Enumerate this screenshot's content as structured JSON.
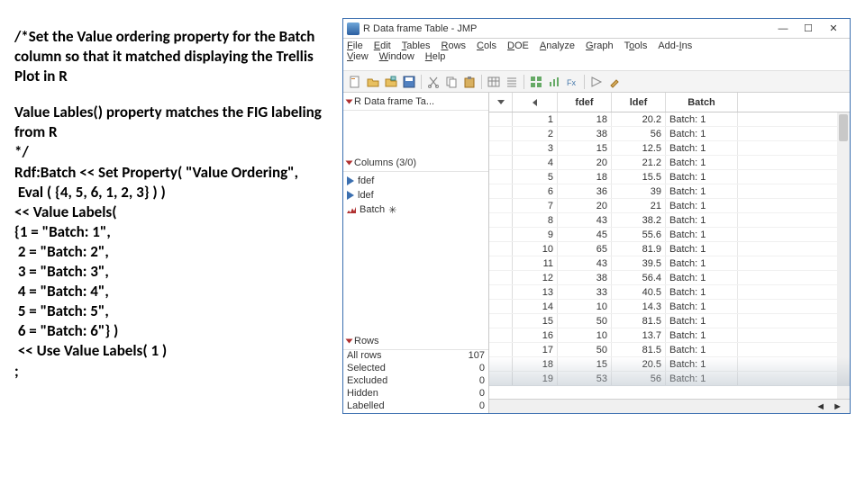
{
  "left": {
    "block1": "/*Set the Value ordering property for the Batch column so that it matched displaying the Trellis Plot in R",
    "block2": "Value Lables() property matches the FIG labeling from R\n*/\nRdf:Batch << Set Property( \"Value Ordering\",\n Eval ( {4, 5, 6, 1, 2, 3} ) )\n<< Value Labels(\n{1 = \"Batch: 1\",\n 2 = \"Batch: 2\",\n 3 = \"Batch: 3\",\n 4 = \"Batch: 4\",\n 5 = \"Batch: 5\",\n 6 = \"Batch: 6\"} )\n << Use Value Labels( 1 )\n;"
  },
  "jmp": {
    "title": "R Data frame Table - JMP",
    "menus": [
      "File",
      "Edit",
      "Tables",
      "Rows",
      "Cols",
      "DOE",
      "Analyze",
      "Graph",
      "Tools",
      "Add-Ins",
      "View",
      "Window",
      "Help"
    ],
    "side_table_label": "R Data frame Ta...",
    "columns_header": "Columns (3/0)",
    "columns": [
      {
        "name": "fdef",
        "type": "blue"
      },
      {
        "name": "ldef",
        "type": "blue"
      },
      {
        "name": "Batch",
        "type": "red",
        "star": "✳"
      }
    ],
    "rows_header": "Rows",
    "rows_stats": [
      {
        "label": "All rows",
        "val": "107"
      },
      {
        "label": "Selected",
        "val": "0"
      },
      {
        "label": "Excluded",
        "val": "0"
      },
      {
        "label": "Hidden",
        "val": "0"
      },
      {
        "label": "Labelled",
        "val": "0"
      }
    ],
    "grid_cols": [
      "fdef",
      "ldef",
      "Batch"
    ],
    "grid_rows": [
      {
        "n": "1",
        "fdef": "18",
        "ldef": "20.2",
        "batch": "Batch: 1"
      },
      {
        "n": "2",
        "fdef": "38",
        "ldef": "56",
        "batch": "Batch: 1"
      },
      {
        "n": "3",
        "fdef": "15",
        "ldef": "12.5",
        "batch": "Batch: 1"
      },
      {
        "n": "4",
        "fdef": "20",
        "ldef": "21.2",
        "batch": "Batch: 1"
      },
      {
        "n": "5",
        "fdef": "18",
        "ldef": "15.5",
        "batch": "Batch: 1"
      },
      {
        "n": "6",
        "fdef": "36",
        "ldef": "39",
        "batch": "Batch: 1"
      },
      {
        "n": "7",
        "fdef": "20",
        "ldef": "21",
        "batch": "Batch: 1"
      },
      {
        "n": "8",
        "fdef": "43",
        "ldef": "38.2",
        "batch": "Batch: 1"
      },
      {
        "n": "9",
        "fdef": "45",
        "ldef": "55.6",
        "batch": "Batch: 1"
      },
      {
        "n": "10",
        "fdef": "65",
        "ldef": "81.9",
        "batch": "Batch: 1"
      },
      {
        "n": "11",
        "fdef": "43",
        "ldef": "39.5",
        "batch": "Batch: 1"
      },
      {
        "n": "12",
        "fdef": "38",
        "ldef": "56.4",
        "batch": "Batch: 1"
      },
      {
        "n": "13",
        "fdef": "33",
        "ldef": "40.5",
        "batch": "Batch: 1"
      },
      {
        "n": "14",
        "fdef": "10",
        "ldef": "14.3",
        "batch": "Batch: 1"
      },
      {
        "n": "15",
        "fdef": "50",
        "ldef": "81.5",
        "batch": "Batch: 1"
      },
      {
        "n": "16",
        "fdef": "10",
        "ldef": "13.7",
        "batch": "Batch: 1"
      },
      {
        "n": "17",
        "fdef": "50",
        "ldef": "81.5",
        "batch": "Batch: 1"
      },
      {
        "n": "18",
        "fdef": "15",
        "ldef": "20.5",
        "batch": "Batch: 1"
      },
      {
        "n": "19",
        "fdef": "53",
        "ldef": "56",
        "batch": "Batch: 1"
      }
    ]
  }
}
